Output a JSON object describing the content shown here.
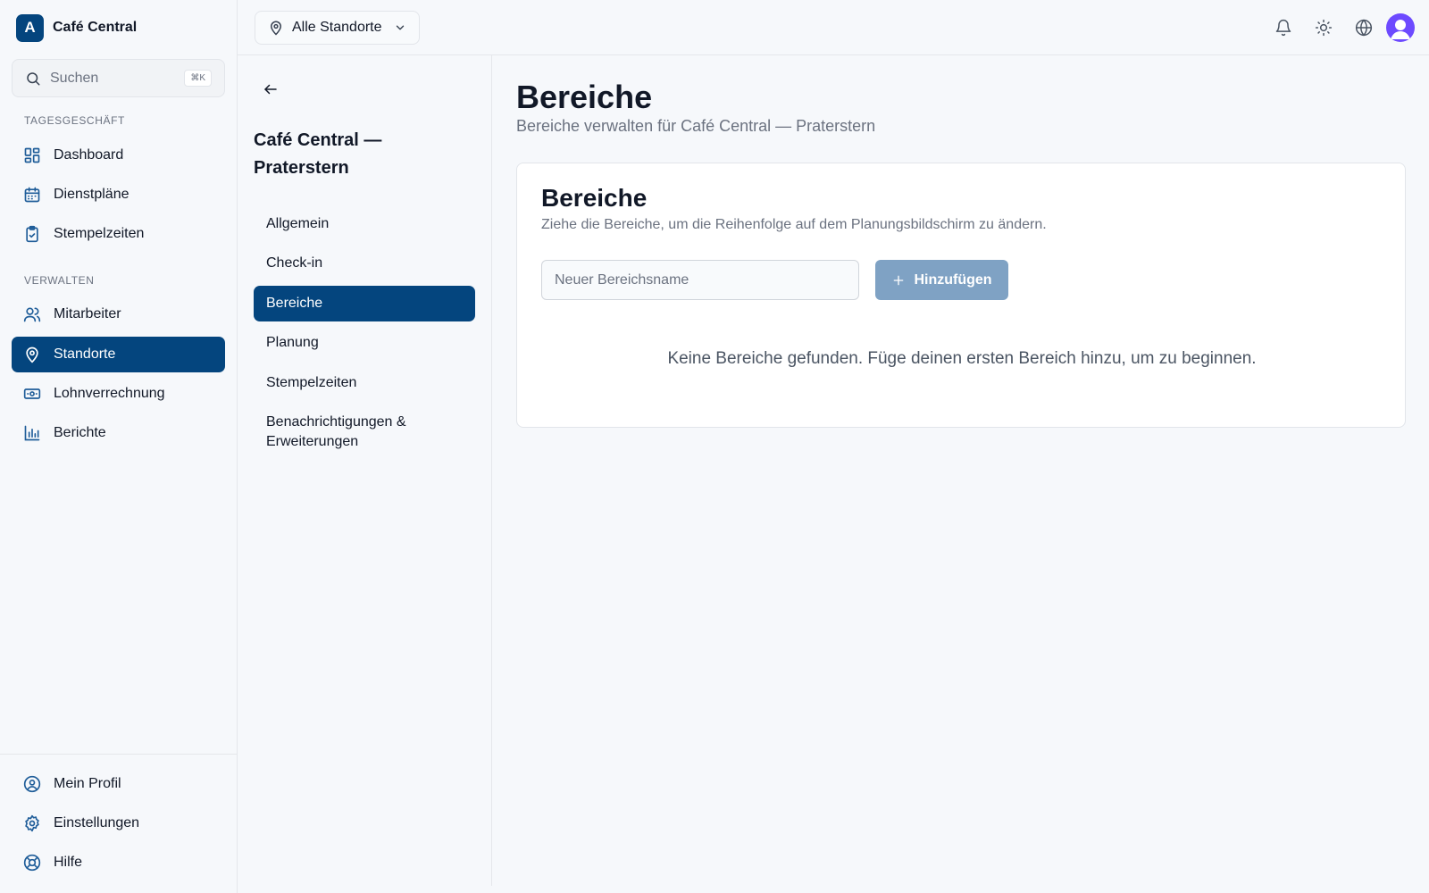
{
  "brand": {
    "logo_letter": "A",
    "name": "Café Central"
  },
  "search": {
    "placeholder": "Suchen",
    "shortcut": "⌘K"
  },
  "sidebar": {
    "sections": [
      {
        "label": "TAGESGESCHÄFT"
      },
      {
        "label": "VERWALTEN"
      }
    ],
    "items": [
      {
        "label": "Dashboard",
        "icon": "dashboard-icon"
      },
      {
        "label": "Dienstpläne",
        "icon": "calendar-icon"
      },
      {
        "label": "Stempelzeiten",
        "icon": "clipboard-check-icon"
      },
      {
        "label": "Mitarbeiter",
        "icon": "users-icon"
      },
      {
        "label": "Standorte",
        "icon": "map-pin-icon",
        "active": true
      },
      {
        "label": "Lohnverrechnung",
        "icon": "banknote-icon"
      },
      {
        "label": "Berichte",
        "icon": "bar-chart-icon"
      }
    ],
    "footer_items": [
      {
        "label": "Mein Profil",
        "icon": "user-circle-icon"
      },
      {
        "label": "Einstellungen",
        "icon": "gear-icon"
      },
      {
        "label": "Hilfe",
        "icon": "lifebuoy-icon"
      }
    ]
  },
  "topbar": {
    "location_select": "Alle Standorte",
    "icons": [
      "bell-icon",
      "sun-icon",
      "globe-icon",
      "avatar"
    ]
  },
  "subnav": {
    "title": "Café Central — Praterstern",
    "items": [
      {
        "label": "Allgemein"
      },
      {
        "label": "Check-in"
      },
      {
        "label": "Bereiche",
        "active": true
      },
      {
        "label": "Planung"
      },
      {
        "label": "Stempelzeiten"
      },
      {
        "label": "Benachrichtigungen & Erweiterungen"
      }
    ]
  },
  "main": {
    "title": "Bereiche",
    "subtitle": "Bereiche verwalten für Café Central — Praterstern",
    "card": {
      "title": "Bereiche",
      "description": "Ziehe die Bereiche, um die Reihenfolge auf dem Planungsbildschirm zu ändern.",
      "input_placeholder": "Neuer Bereichsname",
      "input_value": "",
      "add_button": "Hinzufügen",
      "empty_message": "Keine Bereiche gefunden. Füge deinen ersten Bereich hinzu, um zu beginnen."
    }
  },
  "colors": {
    "primary": "#04457e",
    "primary_disabled": "#7fa2c4",
    "icon_accent": "#1f5d99",
    "avatar": "#6d4aff",
    "background": "#f6f8fb"
  }
}
